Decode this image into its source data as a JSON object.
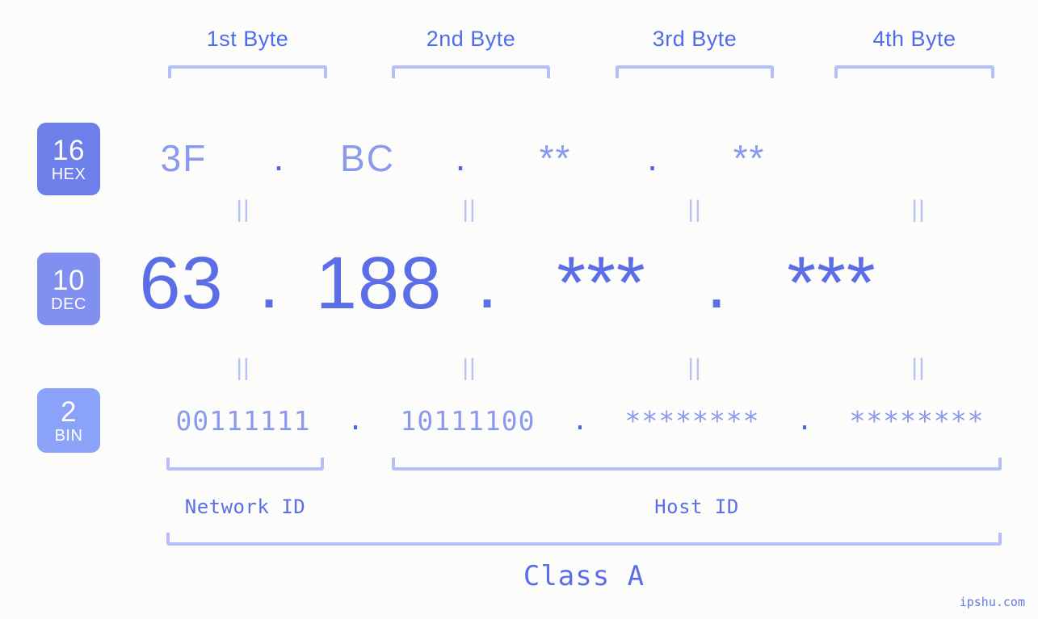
{
  "meta": {
    "background_color": "#fcfdfa",
    "accent_color": "#5b6ee8",
    "light_accent_color": "#8b99ee",
    "bracket_color": "#b5c0fb",
    "separator_color": "#b9c4f5",
    "watermark": "ipshu.com"
  },
  "byte_headers": [
    {
      "label": "1st Byte"
    },
    {
      "label": "2nd Byte"
    },
    {
      "label": "3rd Byte"
    },
    {
      "label": "4th Byte"
    }
  ],
  "bases": [
    {
      "number": "16",
      "abbr": "HEX",
      "color": "#6d7fe8"
    },
    {
      "number": "10",
      "abbr": "DEC",
      "color": "#818ff0"
    },
    {
      "number": "2",
      "abbr": "BIN",
      "color": "#8aa2f7"
    }
  ],
  "rows": {
    "hex": {
      "base": "16",
      "name": "HEX",
      "values": [
        "3F",
        "BC",
        "**",
        "**"
      ],
      "separator": "."
    },
    "dec": {
      "base": "10",
      "name": "DEC",
      "values": [
        "63",
        "188",
        "***",
        "***"
      ],
      "separator": "."
    },
    "bin": {
      "base": "2",
      "name": "BIN",
      "values": [
        "00111111",
        "10111100",
        "********",
        "********"
      ],
      "separator": "."
    }
  },
  "equals_separator": "||",
  "segments": {
    "network_id": {
      "label": "Network ID"
    },
    "host_id": {
      "label": "Host ID"
    },
    "class": {
      "label": "Class A"
    }
  }
}
